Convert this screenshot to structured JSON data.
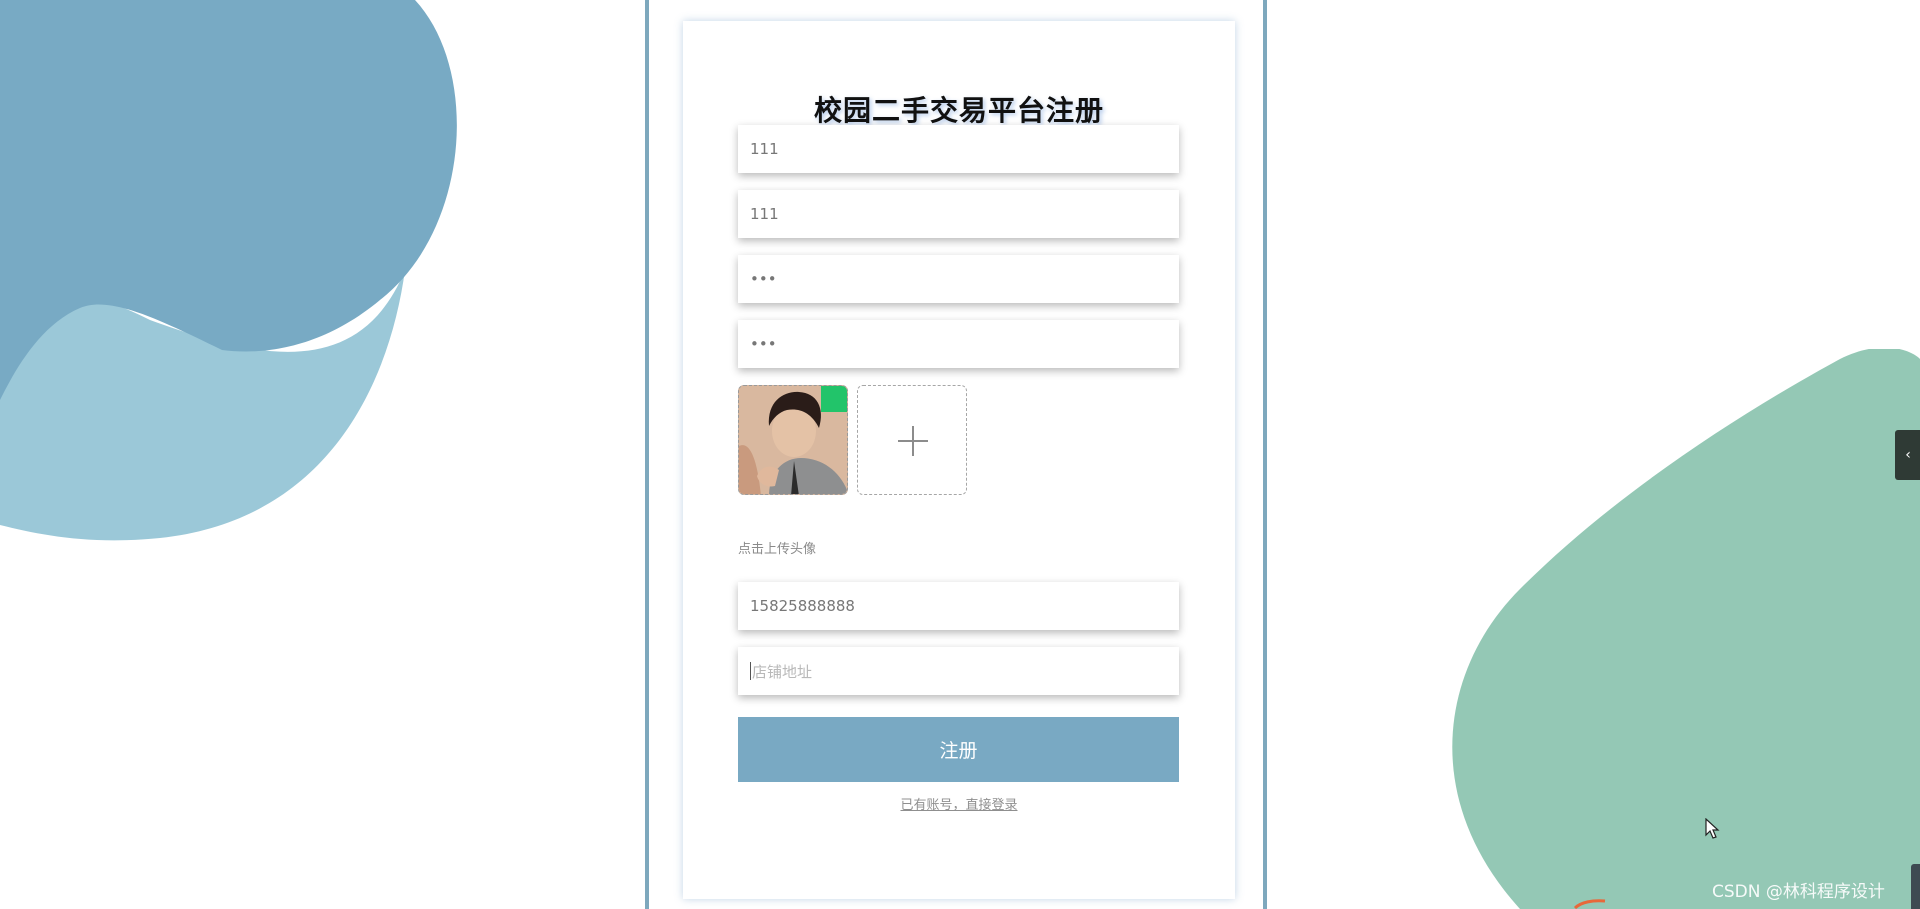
{
  "form": {
    "title": "校园二手交易平台注册",
    "fields": [
      {
        "value": "111"
      },
      {
        "value": "111"
      },
      {
        "value": "•••"
      },
      {
        "value": "•••"
      }
    ],
    "avatar": {
      "upload_hint": "点击上传头像",
      "upload_icon": "plus-icon"
    },
    "phone": {
      "value": "15825888888"
    },
    "address": {
      "placeholder": "店铺地址",
      "value": ""
    },
    "submit_label": "注册",
    "login_link": "已有账号，直接登录"
  },
  "side_panel": {
    "toggle_icon": "chevron-left-icon",
    "toggle_glyph": "‹"
  },
  "watermark": "CSDN @林科程序设计",
  "colors": {
    "accent": "#79a9c3",
    "blob_blue_dark": "#78aac4",
    "blob_blue_light": "#9bc8d8",
    "blob_green": "#94c8b5",
    "blob_mint": "#ace9d8",
    "frame": "#7ea8bd"
  }
}
